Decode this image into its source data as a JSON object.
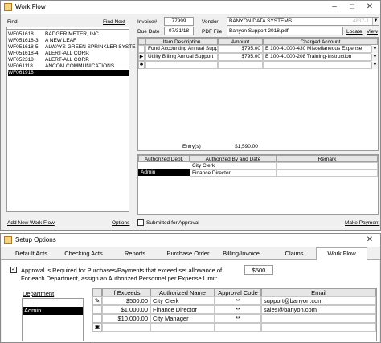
{
  "workflow": {
    "title": "Work Flow",
    "find_label": "Find",
    "find_value": "",
    "find_next": "Find Next",
    "list": [
      {
        "id": "WF051618",
        "name": "BADGER METER, INC"
      },
      {
        "id": "WF051618-3",
        "name": "A NEW LEAF"
      },
      {
        "id": "WF051618-5",
        "name": "ALWAYS GREEN SPRINKLER SYSTE"
      },
      {
        "id": "WF051618-4",
        "name": "ALERT-ALL CORP."
      },
      {
        "id": "WF052318",
        "name": "ALERT-ALL CORP."
      },
      {
        "id": "WF061118",
        "name": "ANCOM COMMUNICATIONS"
      },
      {
        "id": "WF061918",
        "name": ""
      }
    ],
    "add_new": "Add New Work Flow",
    "options": "Options",
    "invoice_label": "Invoice#",
    "invoice_value": "77999",
    "vendor_label": "Vendor",
    "vendor_value": "BANYON DATA SYSTEMS",
    "vendor_code": "4837-1",
    "due_label": "Due Date",
    "due_value": "07/31/18",
    "pdf_label": "PDF File",
    "pdf_value": "Banyon Support 2018.pdf",
    "locate": "Locate",
    "view": "View",
    "items_headers": [
      "Item Description",
      "Amount",
      "Charged Account"
    ],
    "items": [
      {
        "desc": "Fund Accounting Annual Support",
        "amount": "$795.00",
        "account": "E 100-41000-430 Miscellaneous Expense"
      },
      {
        "desc": "Utility Billing Annual Support",
        "amount": "$795.00",
        "account": "E 100-41000-208 Training-Instruction"
      },
      {
        "desc": "",
        "amount": "",
        "account": ""
      }
    ],
    "entries_label": "Entry(s)",
    "total": "$1,590.00",
    "auth_dept_header": "Authorized Dept.",
    "auth_by_header": "Authorized By and Date",
    "remark_header": "Remark",
    "auth_dept_value": "Admin",
    "auth_people": [
      "City Clerk",
      "Finance Director"
    ],
    "submitted_label": "Submitted for Approval",
    "make_payment": "Make Payment"
  },
  "setup": {
    "title": "Setup Options",
    "tabs": [
      "Default Acts",
      "Checking Acts",
      "Reports",
      "Purchase Order",
      "Billing/Invoice",
      "Claims",
      "Work Flow"
    ],
    "active_tab": "Work Flow",
    "approval_text_1": "Approval is Required for Purchases/Payments that exceed set allowance of",
    "approval_text_2": "For each Department, assign an Authorized Personnel per Expense Limit:",
    "allowance": "$500",
    "department_header": "Department",
    "departments": [
      "Admin"
    ],
    "grid_headers": [
      "If Exceeds",
      "Authorized Name",
      "Approval Code",
      "Email"
    ],
    "grid_rows": [
      {
        "exceeds": "$500.00",
        "name": "City Clerk",
        "code": "**",
        "email": "support@banyon.com"
      },
      {
        "exceeds": "$1,000.00",
        "name": "Finance Director",
        "code": "**",
        "email": "sales@banyon.com"
      },
      {
        "exceeds": "$10,000.00",
        "name": "City Manager",
        "code": "**",
        "email": ""
      },
      {
        "exceeds": "",
        "name": "",
        "code": "",
        "email": ""
      }
    ]
  }
}
